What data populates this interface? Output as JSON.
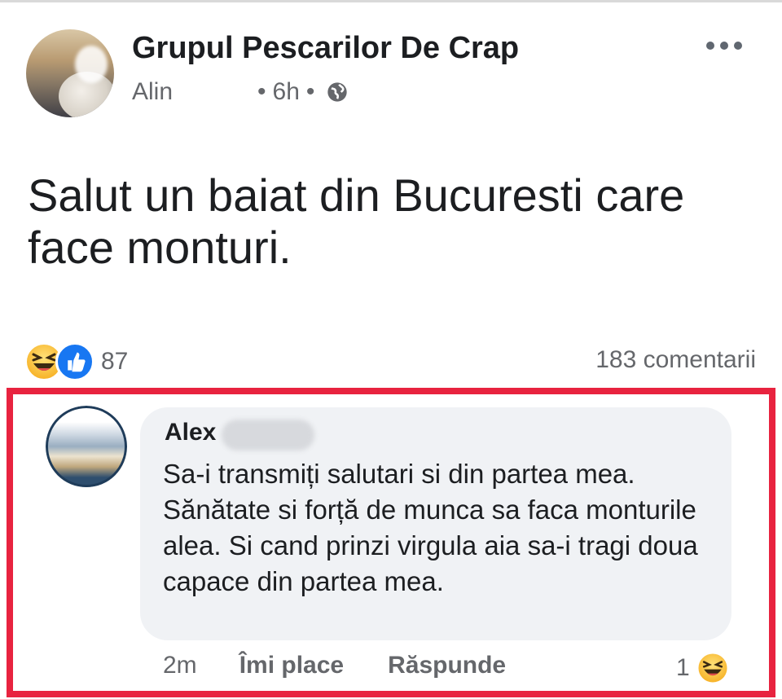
{
  "post": {
    "group_name": "Grupul Pescarilor De Crap",
    "author": "Alin",
    "time": "6h",
    "privacy_icon": "globe-icon",
    "text": "Salut un baiat din Bucuresti care face monturi.",
    "reaction_icons": [
      "haha-icon",
      "like-icon"
    ],
    "reaction_count": "87",
    "comments_count": "183 comentarii"
  },
  "comment": {
    "author": "Alex",
    "text": "Sa-i transmiți salutari si din partea mea. Sănătate si forță de munca sa faca monturile alea. Si cand prinzi virgula aia sa-i tragi doua capace din partea mea.",
    "time": "2m",
    "like_label": "Îmi place",
    "reply_label": "Răspunde",
    "reaction_count": "1",
    "reaction_icon": "haha-icon"
  },
  "colors": {
    "highlight": "#e8233f",
    "bubble": "#f0f2f5",
    "secondary_text": "#65676b",
    "like_blue": "#1877f2"
  }
}
